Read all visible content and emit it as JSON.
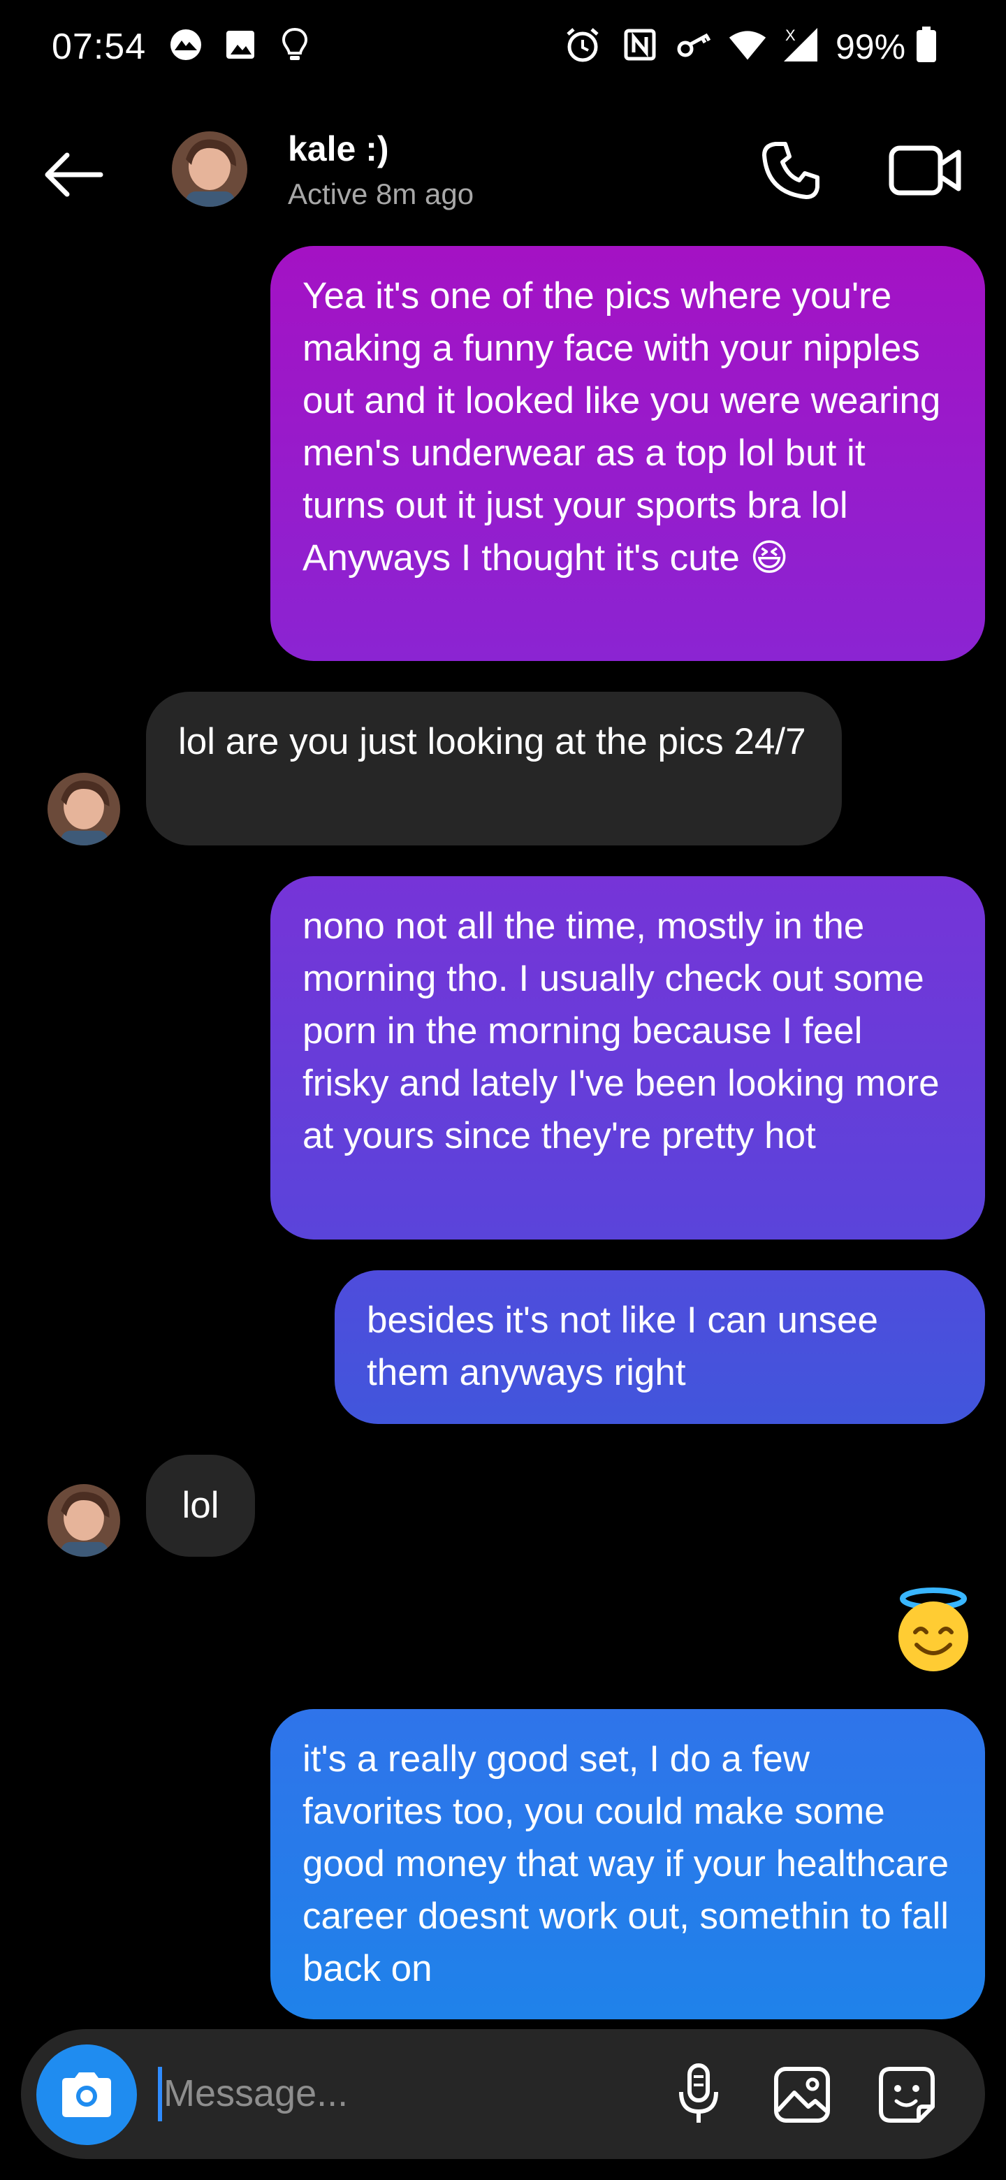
{
  "status_bar": {
    "time": "07:54",
    "battery": "99%",
    "network_label": "X",
    "icons": [
      "app-notification-icon",
      "gallery-icon",
      "lightbulb-icon",
      "alarm-icon",
      "nfc-icon",
      "vpn-key-icon",
      "wifi-icon",
      "cell-signal-icon",
      "battery-icon"
    ]
  },
  "header": {
    "contact_name": "kale :)",
    "status": "Active 8m ago",
    "icons": [
      "back-arrow-icon",
      "phone-icon",
      "video-camera-icon"
    ]
  },
  "messages": [
    {
      "from": "me",
      "text": "Yea it's one of the pics where you're making a funny face with your nipples out and it looked like you were wearing men's underwear as a top lol but it turns out it just your sports bra lol Anyways I thought it's cute 😆"
    },
    {
      "from": "them",
      "text": "lol are you just looking at the pics 24/7"
    },
    {
      "from": "me",
      "text": "nono not all the time, mostly in the morning tho. I usually check out some porn in the morning because I feel frisky and lately I've been looking more at yours since they're pretty hot"
    },
    {
      "from": "me",
      "text": "besides it's not like I can unsee them anyways right"
    },
    {
      "from": "them",
      "text": "lol"
    },
    {
      "from": "me",
      "text": "😇"
    },
    {
      "from": "me",
      "text": "it's a really good set, I do a few favorites too, you could make some good money that way if your healthcare career doesnt work out, somethin to fall back on"
    }
  ],
  "composer": {
    "placeholder": "Message...",
    "icons": [
      "camera-icon",
      "microphone-icon",
      "gallery-icon",
      "sticker-icon"
    ]
  },
  "colors": {
    "background": "#000000",
    "received_bubble": "#262626",
    "gradient_top": "#a412c4",
    "gradient_bottom": "#1f82ea",
    "camera_button": "#1f8cf0"
  }
}
